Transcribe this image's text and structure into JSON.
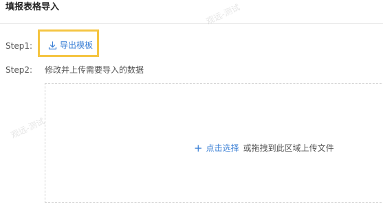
{
  "page": {
    "title": "填报表格导入"
  },
  "step1": {
    "label": "Step1:",
    "export_link": "导出模板",
    "icon": "download-icon"
  },
  "step2": {
    "label": "Step2:",
    "description": "修改并上传需要导入的数据"
  },
  "dropzone": {
    "plus_icon": "+",
    "click_select": "点击选择",
    "drag_hint": "或拖拽到此区域上传文件"
  },
  "watermark": {
    "text": "观远-测试"
  },
  "colors": {
    "accent": "#3a7fd5",
    "highlight": "#f5c542"
  }
}
